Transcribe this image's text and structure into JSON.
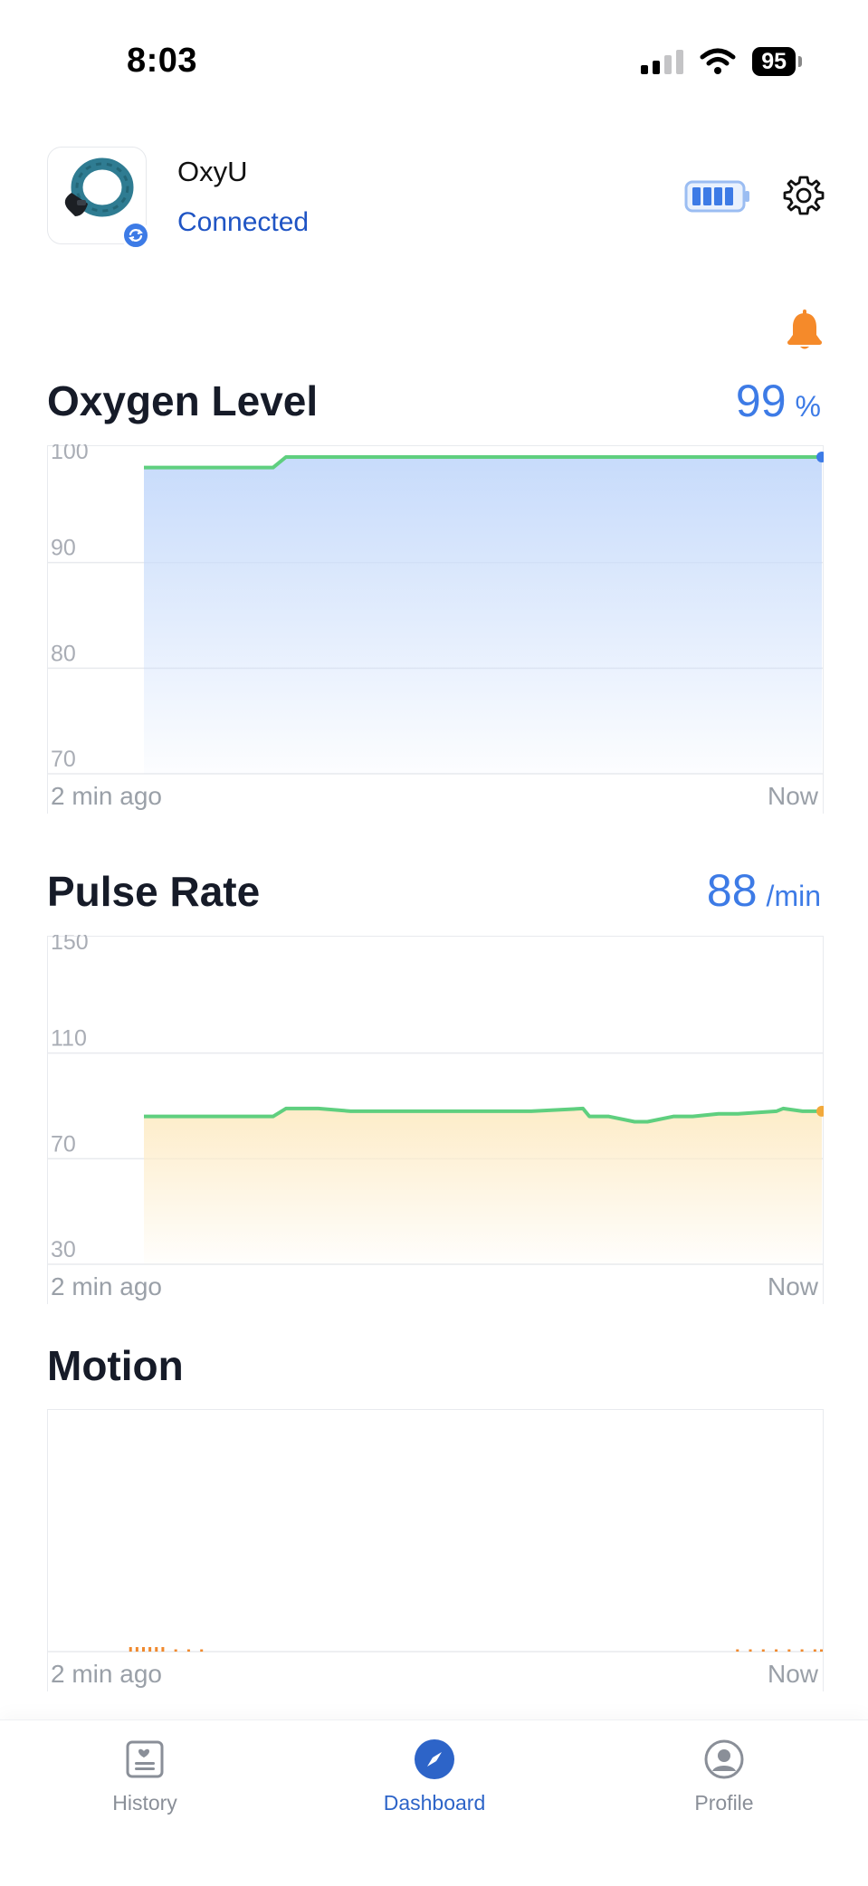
{
  "status_bar": {
    "time": "8:03",
    "battery": "95"
  },
  "device": {
    "name": "OxyU",
    "status": "Connected"
  },
  "oxygen": {
    "title": "Oxygen Level",
    "value": "99",
    "unit": "%",
    "x_start_label": "2 min ago",
    "x_end_label": "Now"
  },
  "pulse": {
    "title": "Pulse Rate",
    "value": "88",
    "unit": "/min",
    "x_start_label": "2 min ago",
    "x_end_label": "Now"
  },
  "motion": {
    "title": "Motion",
    "x_start_label": "2 min ago",
    "x_end_label": "Now"
  },
  "nav": {
    "history": "History",
    "dashboard": "Dashboard",
    "profile": "Profile"
  },
  "colors": {
    "accent": "#3d7be6",
    "line": "#5fcf7f",
    "oxygen_fill": "#c7dbfb",
    "pulse_fill": "#fdecc8",
    "pulse_end_dot": "#f2a93b",
    "motion_marks": "#f0892d",
    "alert": "#f58a2a"
  },
  "chart_data": [
    {
      "type": "area",
      "title": "Oxygen Level",
      "ylim": [
        70,
        100
      ],
      "yticks": [
        "100",
        "90",
        "80",
        "70"
      ],
      "xlabels": [
        "2 min ago",
        "Now"
      ],
      "x_seconds_before_now": [
        105,
        85,
        83,
        0
      ],
      "values": [
        99,
        99,
        100,
        100
      ],
      "grid": true
    },
    {
      "type": "area",
      "title": "Pulse Rate",
      "ylim": [
        30,
        150
      ],
      "yticks": [
        "150",
        "110",
        "70",
        "30"
      ],
      "xlabels": [
        "2 min ago",
        "Now"
      ],
      "x_seconds_before_now": [
        105,
        85,
        83,
        78,
        73,
        62,
        55,
        45,
        37,
        36,
        33,
        29,
        27,
        23,
        20,
        16,
        13,
        7,
        6,
        3,
        0
      ],
      "values": [
        86,
        86,
        89,
        89,
        88,
        88,
        88,
        88,
        89,
        86,
        86,
        84,
        84,
        86,
        86,
        87,
        87,
        88,
        89,
        88,
        88
      ],
      "grid": true
    },
    {
      "type": "bar",
      "title": "Motion",
      "xlabels": [
        "2 min ago",
        "Now"
      ],
      "x_seconds_before_now": [
        107,
        106,
        105,
        104,
        103,
        102,
        100,
        98,
        96,
        13,
        11,
        9,
        7,
        5,
        3,
        1,
        0
      ],
      "values": [
        1,
        1,
        1,
        1,
        1,
        1,
        0.5,
        0.5,
        0.5,
        0.5,
        0.5,
        0.5,
        0.5,
        0.5,
        0.5,
        0.5,
        0.5
      ],
      "grid": false
    }
  ]
}
